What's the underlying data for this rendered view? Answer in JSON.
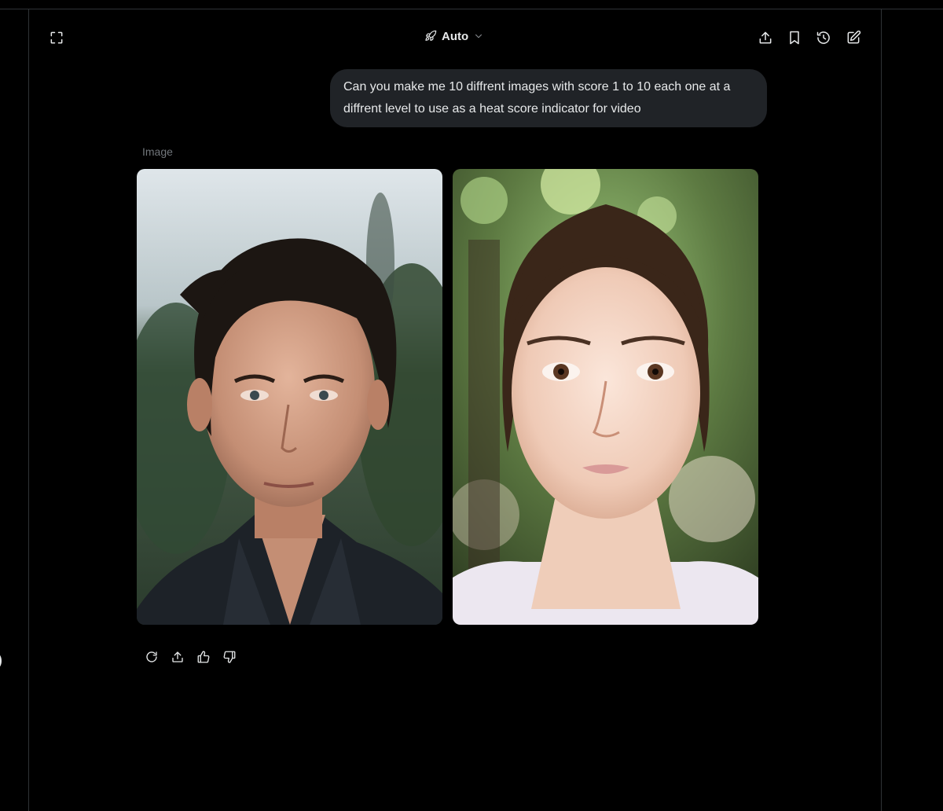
{
  "header": {
    "model_label": "Auto",
    "icons": {
      "fullscreen": "expand-corners-icon",
      "model": "rocket-icon",
      "model_dropdown": "chevron-down-icon",
      "share": "share-upload-icon",
      "bookmark": "bookmark-icon",
      "history": "history-icon",
      "new_chat": "edit-compose-icon"
    }
  },
  "conversation": {
    "user_message": "Can you make me 10 diffrent images with score 1 to 10 each one at a diffrent level to use as a heat score indicator for video",
    "response_label": "Image",
    "images": [
      {
        "subject": "man-portrait",
        "description": "dark-haired man, forest background"
      },
      {
        "subject": "woman-portrait",
        "description": "young woman, green bokeh background"
      }
    ],
    "actions": [
      "regenerate-icon",
      "share-icon",
      "thumbs-up-icon",
      "thumbs-down-icon"
    ]
  },
  "colors": {
    "background": "#000000",
    "bubble": "#202327",
    "text": "#e7e9ea",
    "muted": "#71767b",
    "divider": "#2f3336"
  }
}
